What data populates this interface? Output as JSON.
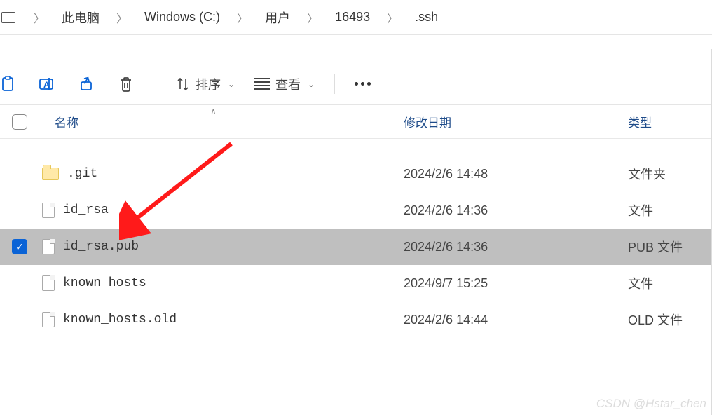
{
  "breadcrumb": {
    "items": [
      "此电脑",
      "Windows (C:)",
      "用户",
      "16493",
      ".ssh"
    ]
  },
  "toolbar": {
    "sort_label": "排序",
    "view_label": "查看"
  },
  "columns": {
    "name": "名称",
    "modified": "修改日期",
    "type": "类型"
  },
  "rows": [
    {
      "icon": "folder",
      "name": ".git",
      "modified": "2024/2/6 14:48",
      "type": "文件夹",
      "selected": false
    },
    {
      "icon": "file",
      "name": "id_rsa",
      "modified": "2024/2/6 14:36",
      "type": "文件",
      "selected": false
    },
    {
      "icon": "file",
      "name": "id_rsa.pub",
      "modified": "2024/2/6 14:36",
      "type": "PUB 文件",
      "selected": true
    },
    {
      "icon": "file",
      "name": "known_hosts",
      "modified": "2024/9/7 15:25",
      "type": "文件",
      "selected": false
    },
    {
      "icon": "file",
      "name": "known_hosts.old",
      "modified": "2024/2/6 14:44",
      "type": "OLD 文件",
      "selected": false
    }
  ],
  "watermark": "CSDN @Hstar_chen"
}
